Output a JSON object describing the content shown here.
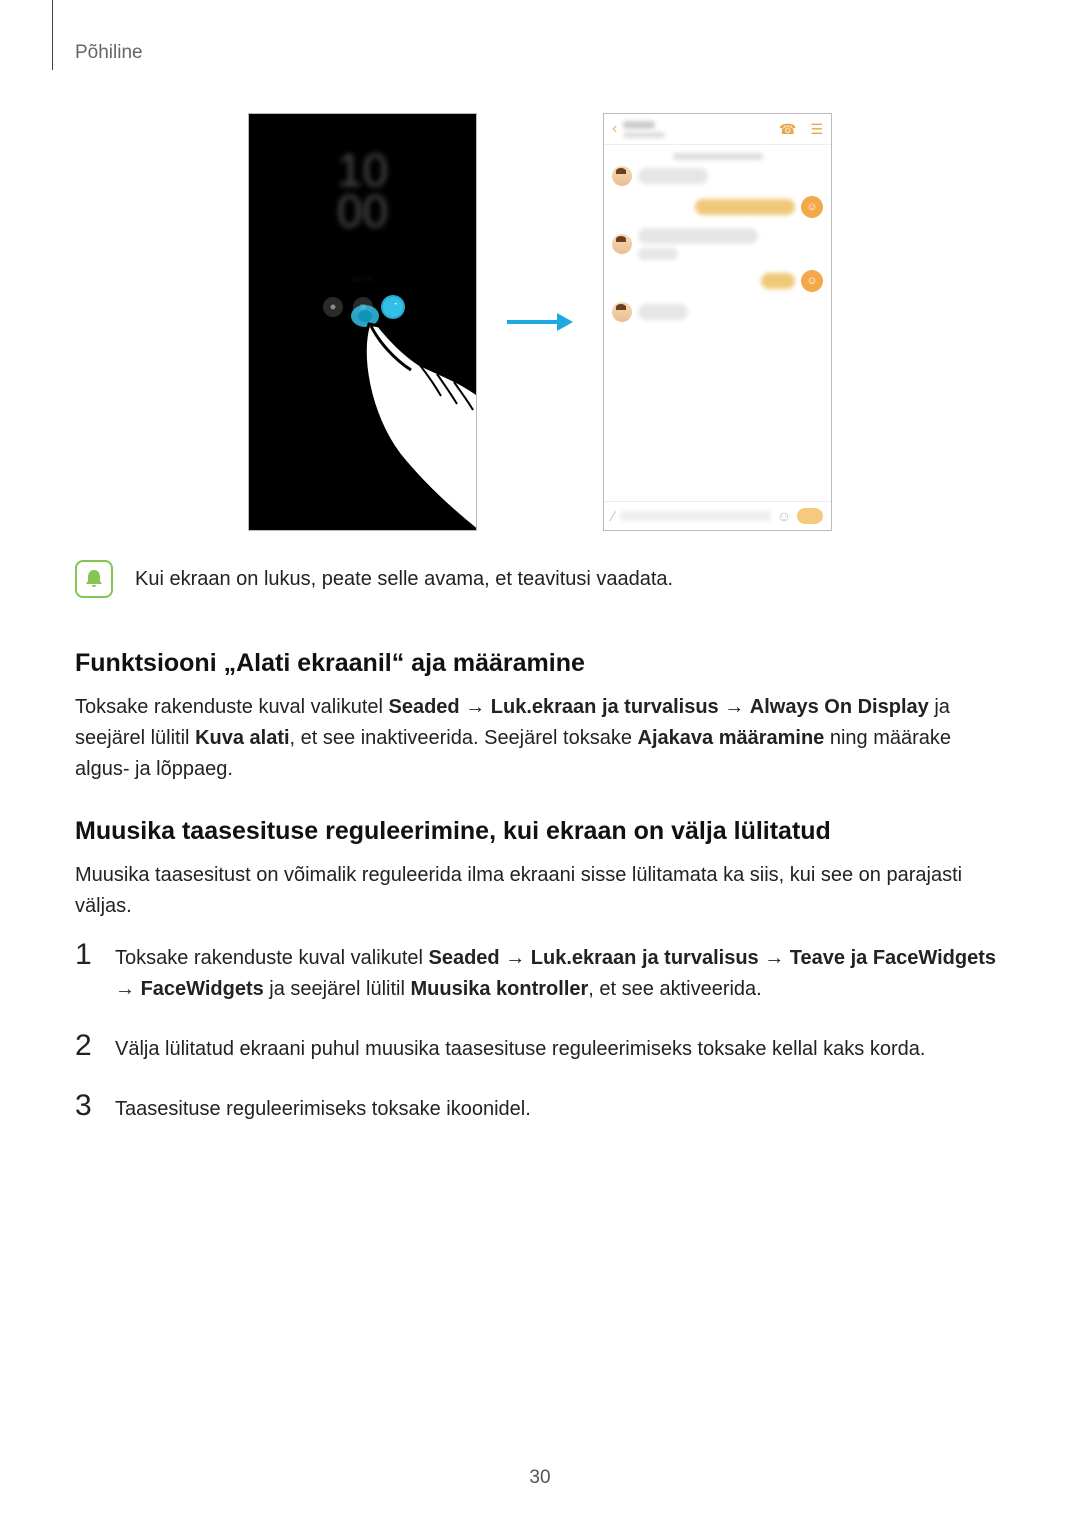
{
  "header": {
    "section": "Põhiline"
  },
  "figure": {
    "clock_top": "10",
    "clock_bottom": "00"
  },
  "note": {
    "text": "Kui ekraan on lukus, peate selle avama, et teavitusi vaadata."
  },
  "section1": {
    "heading": "Funktsiooni „Alati ekraanil“ aja määramine",
    "p_pre": "Toksake rakenduste kuval valikutel ",
    "p_b1": "Seaded",
    "p_arrow": " → ",
    "p_b2": "Luk.ekraan ja turvalisus",
    "p_b3": "Always On Display",
    "p_mid1": " ja seejärel lülitil ",
    "p_b4": "Kuva alati",
    "p_mid2": ", et see inaktiveerida. Seejärel toksake ",
    "p_b5": "Ajakava määramine",
    "p_end": " ning määrake algus- ja lõppaeg."
  },
  "section2": {
    "heading": "Muusika taasesituse reguleerimine, kui ekraan on välja lülitatud",
    "para": "Muusika taasesitust on võimalik reguleerida ilma ekraani sisse lülitamata ka siis, kui see on parajasti väljas."
  },
  "steps": {
    "s1": {
      "num": "1",
      "pre": "Toksake rakenduste kuval valikutel ",
      "b1": "Seaded",
      "arrow": " → ",
      "b2": "Luk.ekraan ja turvalisus",
      "b3": "Teave ja FaceWidgets",
      "b4": "FaceWidgets",
      "mid1": " ja seejärel lülitil ",
      "b5": "Muusika kontroller",
      "end": ", et see aktiveerida."
    },
    "s2": {
      "num": "2",
      "text": "Välja lülitatud ekraani puhul muusika taasesituse reguleerimiseks toksake kellal kaks korda."
    },
    "s3": {
      "num": "3",
      "text": "Taasesituse reguleerimiseks toksake ikoonidel."
    }
  },
  "page": {
    "number": "30"
  }
}
